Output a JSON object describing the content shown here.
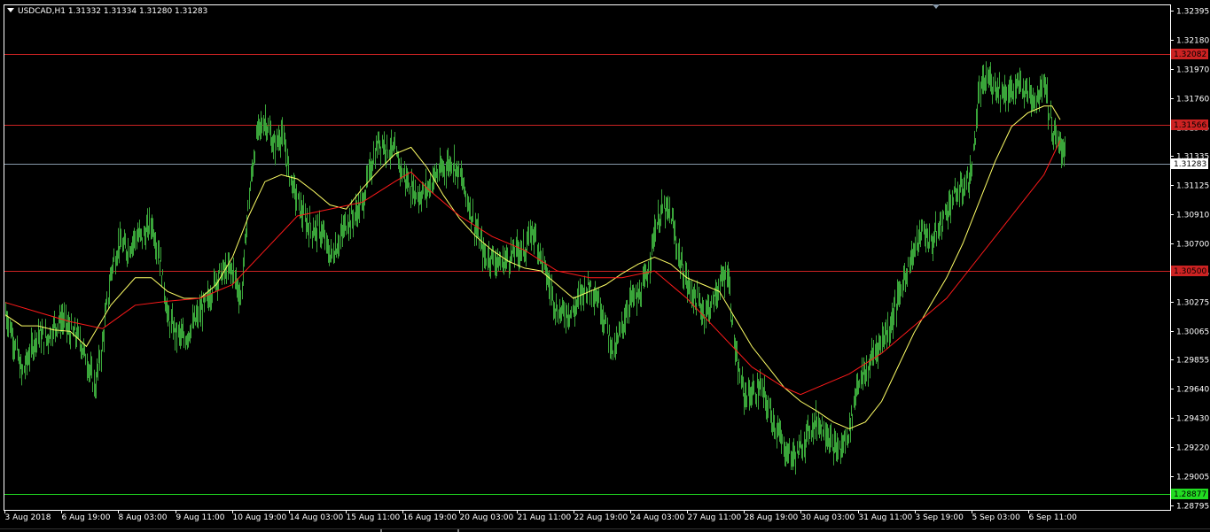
{
  "header": {
    "title": "USDCAD,H1  1.31332 1.31334 1.31280 1.31283",
    "dropdown_icon": "triangle-down-icon",
    "scroll_marker_icon": "triangle-down-icon"
  },
  "colors": {
    "background": "#000000",
    "frame": "#ffffff",
    "bar": "#3aa53a",
    "ma_fast": "#ffff66",
    "ma_slow": "#ff1a1a",
    "level_line": "#cc2222",
    "support_line": "#22dd22",
    "bid_line": "#8899aa"
  },
  "chart_data": {
    "type": "line",
    "symbol": "USDCAD",
    "timeframe": "H1",
    "ohlc_header": {
      "open": 1.31332,
      "high": 1.31334,
      "low": 1.3128,
      "close": 1.31283
    },
    "ylim": [
      1.2876,
      1.3244
    ],
    "y_ticks": [
      "1.32395",
      "1.32180",
      "1.31970",
      "1.31760",
      "1.31545",
      "1.31335",
      "1.31125",
      "1.30910",
      "1.30700",
      "1.30485",
      "1.30275",
      "1.30065",
      "1.29855",
      "1.29640",
      "1.29430",
      "1.29220",
      "1.29005",
      "1.28795"
    ],
    "x_ticks": [
      "3 Aug 2018",
      "6 Aug 19:00",
      "8 Aug 03:00",
      "9 Aug 11:00",
      "10 Aug 19:00",
      "14 Aug 03:00",
      "15 Aug 11:00",
      "16 Aug 19:00",
      "20 Aug 03:00",
      "21 Aug 11:00",
      "22 Aug 19:00",
      "24 Aug 03:00",
      "27 Aug 11:00",
      "28 Aug 19:00",
      "30 Aug 03:00",
      "31 Aug 11:00",
      "3 Sep 19:00",
      "5 Sep 03:00",
      "6 Sep 11:00"
    ],
    "price_tags": [
      {
        "label": "1.32082",
        "value": 1.32082,
        "kind": "level"
      },
      {
        "label": "1.31566",
        "value": 1.31566,
        "kind": "level"
      },
      {
        "label": "1.31283",
        "value": 1.31283,
        "kind": "bid"
      },
      {
        "label": "1.30500",
        "value": 1.305,
        "kind": "level"
      },
      {
        "label": "1.28877",
        "value": 1.28877,
        "kind": "support"
      }
    ],
    "series": [
      {
        "key": "price",
        "style": "bars",
        "values": [
          1.302,
          1.3,
          1.2975,
          1.299,
          1.3005,
          1.3,
          1.301,
          1.3015,
          1.3005,
          1.3002,
          1.2985,
          1.2965,
          1.3,
          1.305,
          1.307,
          1.3065,
          1.3075,
          1.3075,
          1.3085,
          1.306,
          1.3015,
          1.3005,
          1.3,
          1.301,
          1.302,
          1.303,
          1.3045,
          1.305,
          1.305,
          1.303,
          1.3105,
          1.315,
          1.316,
          1.314,
          1.315,
          1.312,
          1.31,
          1.3085,
          1.308,
          1.3078,
          1.306,
          1.307,
          1.3085,
          1.309,
          1.31,
          1.3125,
          1.3145,
          1.314,
          1.3135,
          1.312,
          1.311,
          1.3105,
          1.311,
          1.312,
          1.3125,
          1.313,
          1.312,
          1.31,
          1.308,
          1.306,
          1.306,
          1.3055,
          1.306,
          1.3065,
          1.3065,
          1.308,
          1.306,
          1.304,
          1.302,
          1.302,
          1.302,
          1.3035,
          1.304,
          1.303,
          1.301,
          1.299,
          1.301,
          1.303,
          1.303,
          1.3045,
          1.308,
          1.3095,
          1.309,
          1.306,
          1.304,
          1.303,
          1.302,
          1.3025,
          1.304,
          1.305,
          1.2985,
          1.296,
          1.296,
          1.2965,
          1.295,
          1.2935,
          1.292,
          1.2915,
          1.292,
          1.2935,
          1.294,
          1.2935,
          1.292,
          1.292,
          1.2935,
          1.297,
          1.2975,
          1.299,
          1.3,
          1.301,
          1.303,
          1.305,
          1.3065,
          1.308,
          1.307,
          1.308,
          1.3095,
          1.3105,
          1.311,
          1.312,
          1.318,
          1.319,
          1.3185,
          1.318,
          1.318,
          1.3185,
          1.318,
          1.3175,
          1.319,
          1.315,
          1.314
        ]
      },
      {
        "key": "ma_fast",
        "style": "line",
        "values": [
          [
            0,
            1.3018
          ],
          [
            2,
            1.301
          ],
          [
            4,
            1.301
          ],
          [
            6,
            1.3007
          ],
          [
            8,
            1.3006
          ],
          [
            10,
            1.2995
          ],
          [
            13,
            1.3025
          ],
          [
            16,
            1.3045
          ],
          [
            18,
            1.3045
          ],
          [
            20,
            1.3035
          ],
          [
            22,
            1.303
          ],
          [
            24,
            1.303
          ],
          [
            26,
            1.304
          ],
          [
            28,
            1.306
          ],
          [
            30,
            1.309
          ],
          [
            32,
            1.3115
          ],
          [
            34,
            1.312
          ],
          [
            36,
            1.3117
          ],
          [
            38,
            1.3108
          ],
          [
            40,
            1.3098
          ],
          [
            42,
            1.3095
          ],
          [
            44,
            1.311
          ],
          [
            46,
            1.3123
          ],
          [
            48,
            1.3135
          ],
          [
            50,
            1.314
          ],
          [
            52,
            1.3125
          ],
          [
            54,
            1.3105
          ],
          [
            56,
            1.3088
          ],
          [
            58,
            1.3075
          ],
          [
            60,
            1.3065
          ],
          [
            62,
            1.3057
          ],
          [
            64,
            1.3052
          ],
          [
            66,
            1.305
          ],
          [
            68,
            1.304
          ],
          [
            70,
            1.303
          ],
          [
            72,
            1.3035
          ],
          [
            74,
            1.304
          ],
          [
            76,
            1.3048
          ],
          [
            78,
            1.3055
          ],
          [
            80,
            1.306
          ],
          [
            82,
            1.3055
          ],
          [
            84,
            1.3045
          ],
          [
            86,
            1.304
          ],
          [
            88,
            1.3035
          ],
          [
            90,
            1.3015
          ],
          [
            92,
            1.2995
          ],
          [
            94,
            1.298
          ],
          [
            96,
            1.2965
          ],
          [
            98,
            1.2955
          ],
          [
            100,
            1.2948
          ],
          [
            102,
            1.294
          ],
          [
            104,
            1.2935
          ],
          [
            106,
            1.294
          ],
          [
            108,
            1.2955
          ],
          [
            110,
            1.298
          ],
          [
            112,
            1.3005
          ],
          [
            114,
            1.3025
          ],
          [
            116,
            1.3045
          ],
          [
            118,
            1.307
          ],
          [
            120,
            1.31
          ],
          [
            122,
            1.313
          ],
          [
            124,
            1.3155
          ],
          [
            126,
            1.3165
          ],
          [
            128,
            1.317
          ],
          [
            129,
            1.317
          ],
          [
            130,
            1.316
          ]
        ]
      },
      {
        "key": "ma_slow",
        "style": "line",
        "values": [
          [
            0,
            1.3027
          ],
          [
            4,
            1.302
          ],
          [
            8,
            1.3013
          ],
          [
            12,
            1.3008
          ],
          [
            16,
            1.3025
          ],
          [
            20,
            1.3028
          ],
          [
            24,
            1.303
          ],
          [
            28,
            1.304
          ],
          [
            32,
            1.3065
          ],
          [
            36,
            1.309
          ],
          [
            40,
            1.3095
          ],
          [
            44,
            1.31
          ],
          [
            48,
            1.3115
          ],
          [
            50,
            1.3122
          ],
          [
            52,
            1.311
          ],
          [
            56,
            1.309
          ],
          [
            60,
            1.3075
          ],
          [
            64,
            1.3065
          ],
          [
            68,
            1.305
          ],
          [
            72,
            1.3045
          ],
          [
            76,
            1.3045
          ],
          [
            80,
            1.305
          ],
          [
            84,
            1.303
          ],
          [
            88,
            1.3005
          ],
          [
            92,
            1.298
          ],
          [
            96,
            1.2965
          ],
          [
            98,
            1.296
          ],
          [
            100,
            1.2965
          ],
          [
            104,
            1.2975
          ],
          [
            108,
            1.299
          ],
          [
            112,
            1.301
          ],
          [
            116,
            1.303
          ],
          [
            120,
            1.306
          ],
          [
            124,
            1.309
          ],
          [
            128,
            1.312
          ],
          [
            130,
            1.3145
          ]
        ]
      }
    ]
  }
}
